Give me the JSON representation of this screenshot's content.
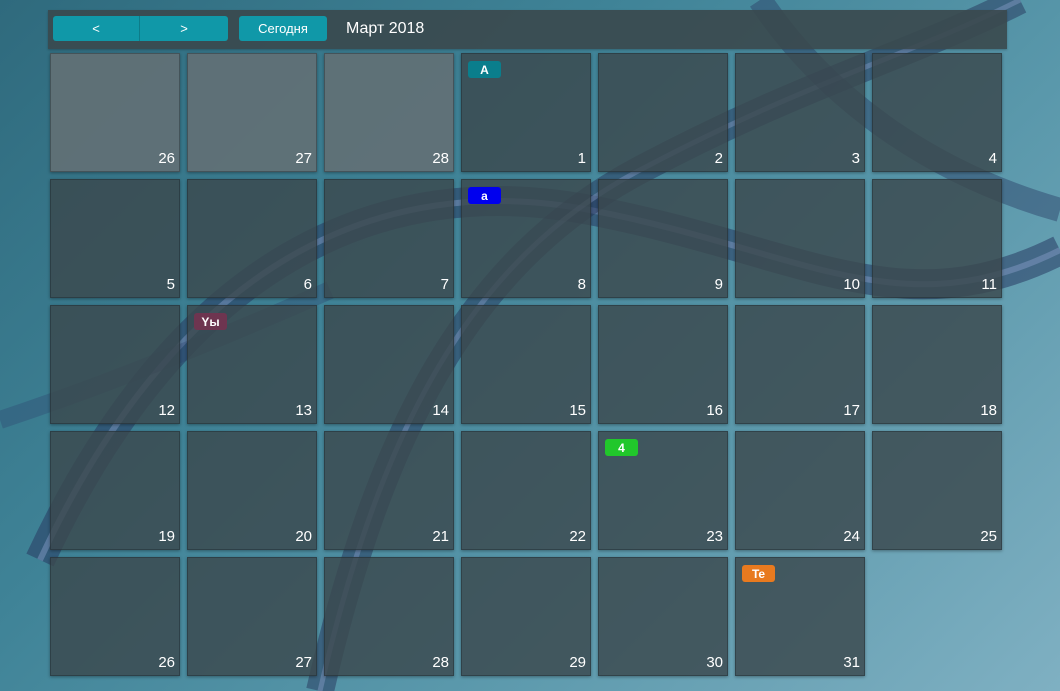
{
  "toolbar": {
    "prev_label": "<",
    "next_label": ">",
    "today_label": "Сегодня",
    "month_title": "Март 2018"
  },
  "calendar": {
    "weeks": [
      [
        {
          "day": "26",
          "other_month": true
        },
        {
          "day": "27",
          "other_month": true
        },
        {
          "day": "28",
          "other_month": true
        },
        {
          "day": "1",
          "event": {
            "label": "A",
            "color": "#0a7e8c"
          }
        },
        {
          "day": "2"
        },
        {
          "day": "3"
        },
        {
          "day": "4"
        }
      ],
      [
        {
          "day": "5"
        },
        {
          "day": "6"
        },
        {
          "day": "7"
        },
        {
          "day": "8",
          "event": {
            "label": "a",
            "color": "#0000ee"
          }
        },
        {
          "day": "9"
        },
        {
          "day": "10"
        },
        {
          "day": "11"
        }
      ],
      [
        {
          "day": "12"
        },
        {
          "day": "13",
          "event": {
            "label": "Yы",
            "color": "#6e3550"
          }
        },
        {
          "day": "14"
        },
        {
          "day": "15"
        },
        {
          "day": "16"
        },
        {
          "day": "17"
        },
        {
          "day": "18"
        }
      ],
      [
        {
          "day": "19"
        },
        {
          "day": "20"
        },
        {
          "day": "21"
        },
        {
          "day": "22"
        },
        {
          "day": "23",
          "event": {
            "label": "4",
            "color": "#21c72b"
          }
        },
        {
          "day": "24"
        },
        {
          "day": "25"
        }
      ],
      [
        {
          "day": "26"
        },
        {
          "day": "27"
        },
        {
          "day": "28"
        },
        {
          "day": "29"
        },
        {
          "day": "30"
        },
        {
          "day": "31",
          "event": {
            "label": "Te",
            "color": "#e87a1f"
          }
        }
      ]
    ]
  }
}
